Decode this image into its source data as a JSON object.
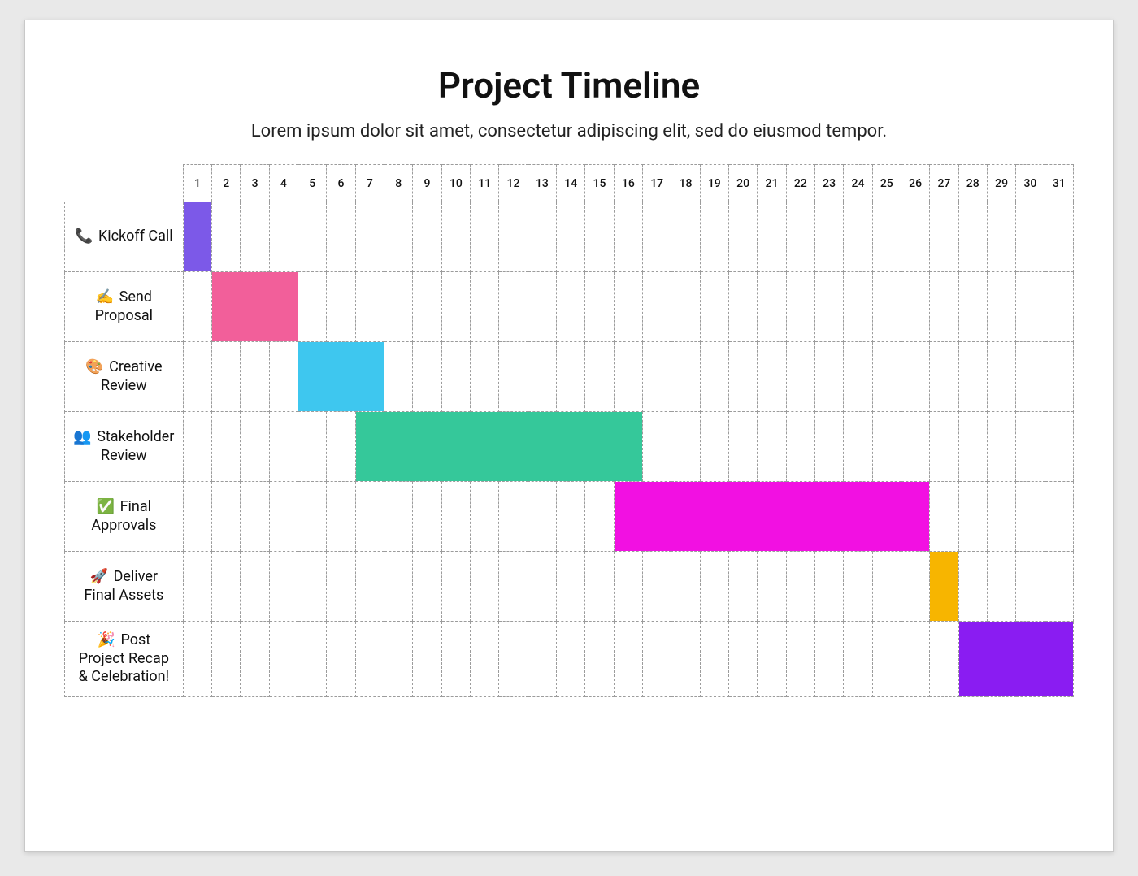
{
  "title": "Project Timeline",
  "subtitle": "Lorem ipsum dolor sit amet, consectetur adipiscing elit, sed do eiusmod tempor.",
  "chart_data": {
    "type": "bar",
    "orientation": "gantt",
    "days": [
      1,
      2,
      3,
      4,
      5,
      6,
      7,
      8,
      9,
      10,
      11,
      12,
      13,
      14,
      15,
      16,
      17,
      18,
      19,
      20,
      21,
      22,
      23,
      24,
      25,
      26,
      27,
      28,
      29,
      30,
      31
    ],
    "xlabel": "",
    "ylabel": "",
    "xlim": [
      1,
      31
    ],
    "tasks": [
      {
        "emoji": "📞",
        "label": "Kickoff Call",
        "start": 1,
        "end": 1,
        "color": "#7c59e8"
      },
      {
        "emoji": "✍️",
        "label": "Send Proposal",
        "start": 2,
        "end": 4,
        "color": "#f25f9a"
      },
      {
        "emoji": "🎨",
        "label": "Creative Review",
        "start": 5,
        "end": 7,
        "color": "#3ec7ef"
      },
      {
        "emoji": "👥",
        "label": "Stakeholder Review",
        "start": 7,
        "end": 16,
        "color": "#35c89a"
      },
      {
        "emoji": "✅",
        "label": "Final Approvals",
        "start": 16,
        "end": 26,
        "color": "#f210e2"
      },
      {
        "emoji": "🚀",
        "label": "Deliver Final Assets",
        "start": 27,
        "end": 27,
        "color": "#f7b500"
      },
      {
        "emoji": "🎉",
        "label": "Post Project Recap & Celebration!",
        "start": 28,
        "end": 31,
        "color": "#8a1cf2"
      }
    ]
  }
}
